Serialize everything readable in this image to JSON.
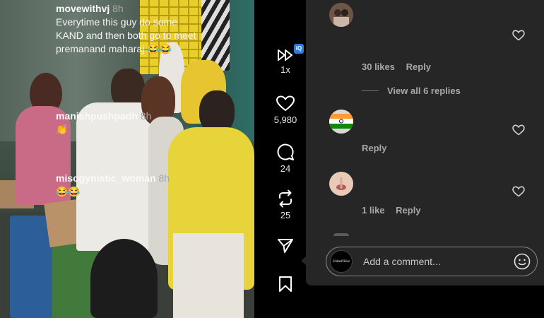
{
  "rail": {
    "playback_speed": "1x",
    "likes": "5,980",
    "comments": "24",
    "reposts": "25",
    "badge": "iQ"
  },
  "comments": [
    {
      "username": "movewithvj",
      "time": "8h",
      "text": "Everytime this guy do some KAND and then both go to meet premanand maharaj 😂😂",
      "likes": "30 likes",
      "reply": "Reply",
      "view_replies": "View all 6 replies"
    },
    {
      "username": "manishpushpadh",
      "time": "8h",
      "text": "👏",
      "reply": "Reply"
    },
    {
      "username": "misogynistic_woman",
      "time": "8h",
      "text": "😂😂",
      "likes": "1 like",
      "reply": "Reply"
    }
  ],
  "composer": {
    "placeholder": "Add a comment...",
    "avatar_text": "UnitedVoice"
  },
  "icons": {
    "playback": "fast-forward-icon",
    "like": "heart-icon",
    "comment": "comment-icon",
    "repost": "repost-icon",
    "share": "send-icon",
    "save": "bookmark-icon",
    "emoji": "smiley-icon"
  },
  "colors": {
    "panel_bg": "#262626",
    "text_primary": "#f5f5f5",
    "text_secondary": "#a8a8a8"
  }
}
